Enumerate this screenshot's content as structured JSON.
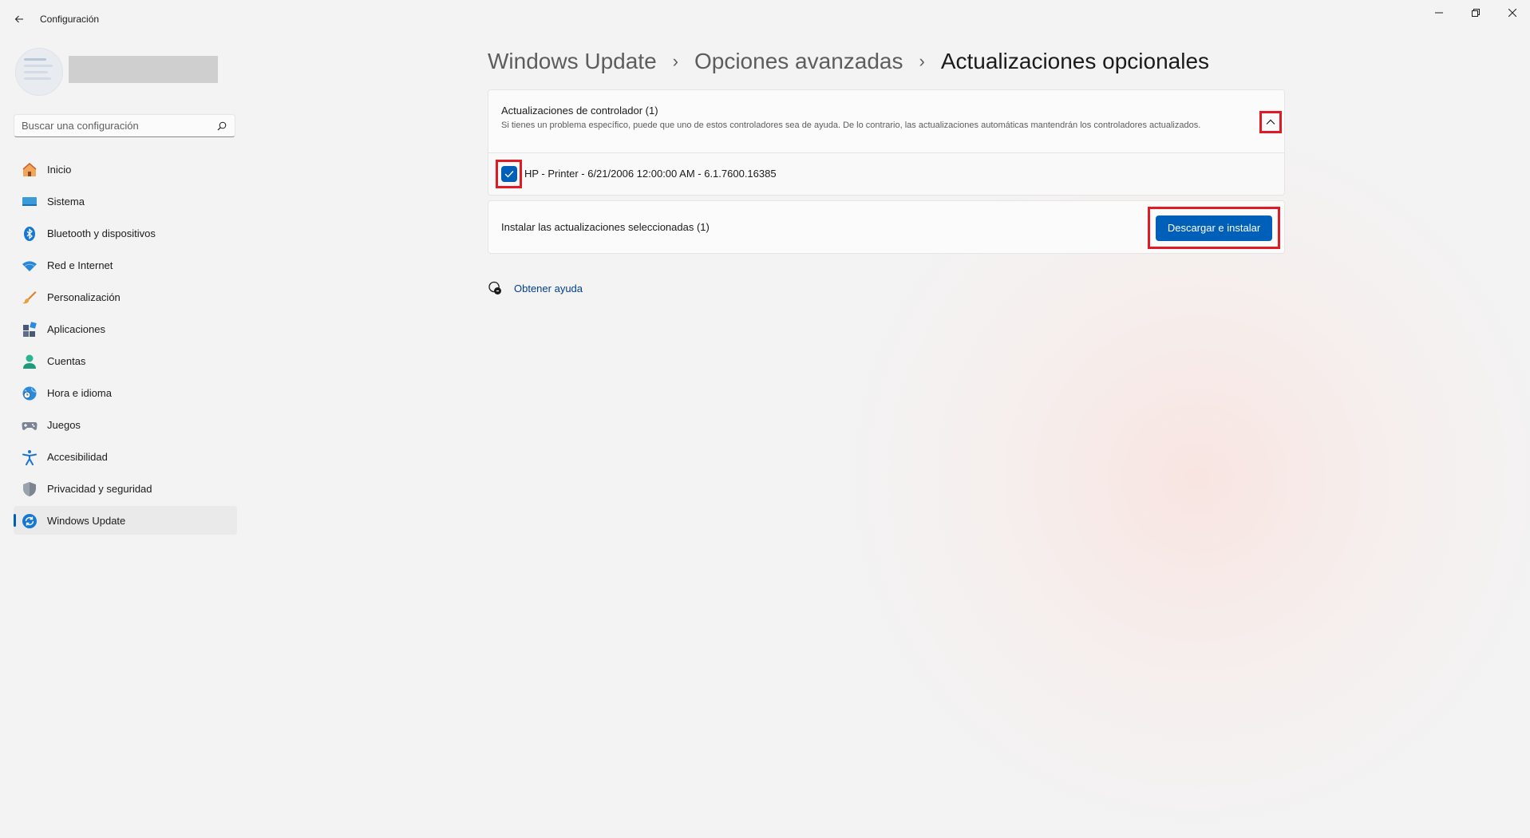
{
  "window": {
    "title": "Configuración",
    "controls": [
      "minimize-icon",
      "restore-icon",
      "close-icon"
    ]
  },
  "search": {
    "placeholder": "Buscar una configuración"
  },
  "sidebar": {
    "items": [
      {
        "label": "Inicio",
        "icon": "home-icon"
      },
      {
        "label": "Sistema",
        "icon": "system-icon"
      },
      {
        "label": "Bluetooth y dispositivos",
        "icon": "bluetooth-icon"
      },
      {
        "label": "Red e Internet",
        "icon": "wifi-icon"
      },
      {
        "label": "Personalización",
        "icon": "brush-icon"
      },
      {
        "label": "Aplicaciones",
        "icon": "apps-icon"
      },
      {
        "label": "Cuentas",
        "icon": "account-icon"
      },
      {
        "label": "Hora e idioma",
        "icon": "globe-clock-icon"
      },
      {
        "label": "Juegos",
        "icon": "gamepad-icon"
      },
      {
        "label": "Accesibilidad",
        "icon": "accessibility-icon"
      },
      {
        "label": "Privacidad y seguridad",
        "icon": "shield-icon"
      },
      {
        "label": "Windows Update",
        "icon": "update-icon",
        "active": true
      }
    ]
  },
  "breadcrumb": [
    "Windows Update",
    "Opciones avanzadas",
    "Actualizaciones opcionales"
  ],
  "driver_updates": {
    "title": "Actualizaciones de controlador (1)",
    "description": "Si tienes un problema específico, puede que uno de estos controladores sea de ayuda. De lo contrario, las actualizaciones automáticas mantendrán los controladores actualizados.",
    "expanded": true,
    "items": [
      {
        "label": "HP - Printer - 6/21/2006 12:00:00 AM - 6.1.7600.16385",
        "checked": true
      }
    ]
  },
  "install": {
    "label": "Instalar las actualizaciones seleccionadas (1)",
    "button": "Descargar e instalar"
  },
  "help": {
    "label": "Obtener ayuda"
  },
  "colors": {
    "accent": "#005fb8",
    "highlight": "#e01b24",
    "link": "#003e92"
  }
}
